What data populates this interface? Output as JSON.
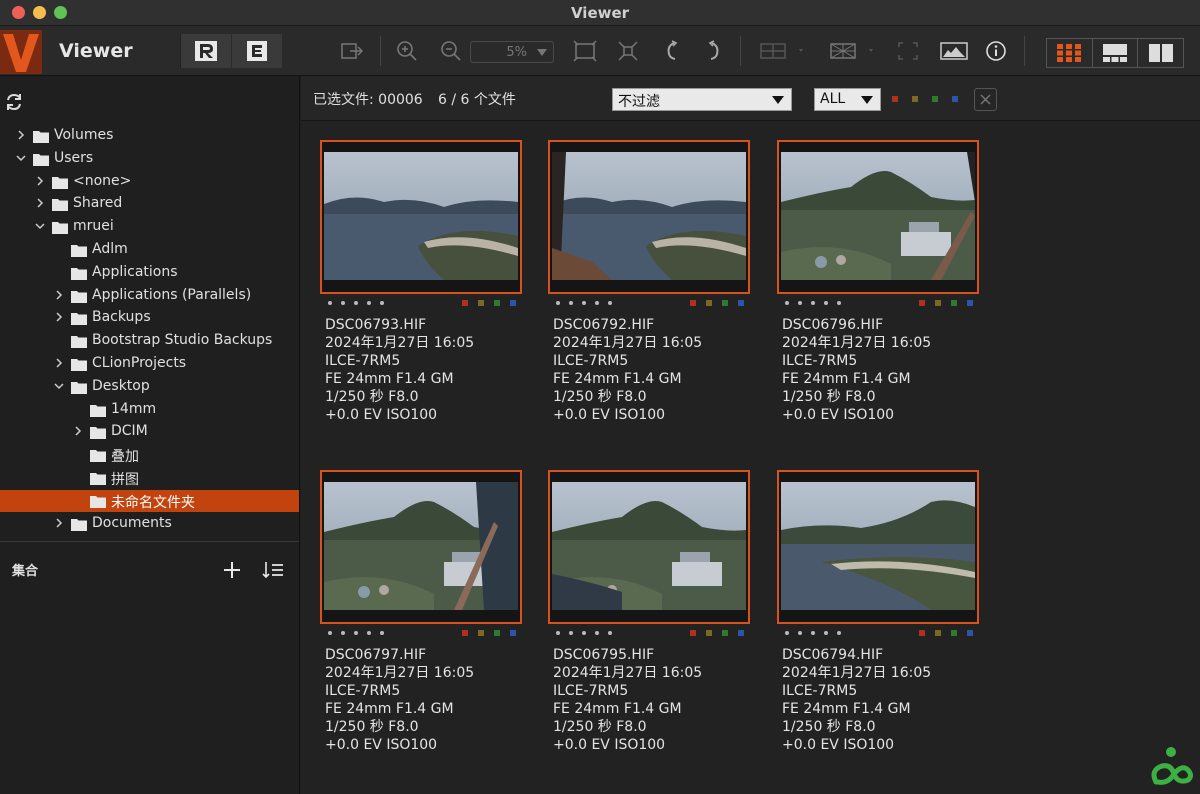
{
  "window": {
    "title": "Viewer"
  },
  "app": {
    "name": "Viewer",
    "logo_letter": "V"
  },
  "toolbar": {
    "zoom": "5%",
    "icons": [
      "edit-r-icon",
      "export-e-icon",
      "export-arrow-icon",
      "zoom-in-icon",
      "zoom-out-icon",
      "fit-icon",
      "actual-size-icon",
      "rotate-left-icon",
      "rotate-right-icon",
      "compare-icon",
      "grid-overlay-icon",
      "crop-icon",
      "histogram-icon",
      "info-icon",
      "grid-view-icon",
      "browser-view-icon",
      "dual-view-icon"
    ]
  },
  "sidebar": {
    "tree": [
      {
        "label": "Volumes",
        "indent": 0,
        "chevron": "right"
      },
      {
        "label": "Users",
        "indent": 0,
        "chevron": "down"
      },
      {
        "label": "<none>",
        "indent": 1,
        "chevron": "right"
      },
      {
        "label": "Shared",
        "indent": 1,
        "chevron": "right"
      },
      {
        "label": "mruei",
        "indent": 1,
        "chevron": "down"
      },
      {
        "label": "Adlm",
        "indent": 2,
        "chevron": ""
      },
      {
        "label": "Applications",
        "indent": 2,
        "chevron": ""
      },
      {
        "label": "Applications (Parallels)",
        "indent": 2,
        "chevron": "right"
      },
      {
        "label": "Backups",
        "indent": 2,
        "chevron": "right"
      },
      {
        "label": "Bootstrap Studio Backups",
        "indent": 2,
        "chevron": ""
      },
      {
        "label": "CLionProjects",
        "indent": 2,
        "chevron": "right"
      },
      {
        "label": "Desktop",
        "indent": 2,
        "chevron": "down"
      },
      {
        "label": "14mm",
        "indent": 3,
        "chevron": ""
      },
      {
        "label": "DCIM",
        "indent": 3,
        "chevron": "right"
      },
      {
        "label": "叠加",
        "indent": 3,
        "chevron": ""
      },
      {
        "label": "拼图",
        "indent": 3,
        "chevron": ""
      },
      {
        "label": "未命名文件夹",
        "indent": 3,
        "chevron": "",
        "selected": true
      },
      {
        "label": "Documents",
        "indent": 2,
        "chevron": "right"
      }
    ],
    "collections_label": "集合"
  },
  "filterbar": {
    "selected_files": "已选文件: 00006",
    "file_count": "6 / 6 个文件",
    "filter_value": "不过滤",
    "all_value": "ALL",
    "color_labels": [
      "#b03020",
      "#7a6a20",
      "#2e7a30",
      "#2a55a8"
    ]
  },
  "thumbnails": [
    {
      "filename": "DSC06793.HIF",
      "date": "2024年1月27日 16:05",
      "camera": "ILCE-7RM5",
      "lens": "FE 24mm F1.4 GM",
      "exposure": "1/250 秒 F8.0",
      "ev_iso": "+0.0 EV ISO100",
      "scene": "lake"
    },
    {
      "filename": "DSC06792.HIF",
      "date": "2024年1月27日 16:05",
      "camera": "ILCE-7RM5",
      "lens": "FE 24mm F1.4 GM",
      "exposure": "1/250 秒 F8.0",
      "ev_iso": "+0.0 EV ISO100",
      "scene": "lake-wide"
    },
    {
      "filename": "DSC06796.HIF",
      "date": "2024年1月27日 16:05",
      "camera": "ILCE-7RM5",
      "lens": "FE 24mm F1.4 GM",
      "exposure": "1/250 秒 F8.0",
      "ev_iso": "+0.0 EV ISO100",
      "scene": "hill"
    },
    {
      "filename": "DSC06797.HIF",
      "date": "2024年1月27日 16:05",
      "camera": "ILCE-7RM5",
      "lens": "FE 24mm F1.4 GM",
      "exposure": "1/250 秒 F8.0",
      "ev_iso": "+0.0 EV ISO100",
      "scene": "hill-window"
    },
    {
      "filename": "DSC06795.HIF",
      "date": "2024年1月27日 16:05",
      "camera": "ILCE-7RM5",
      "lens": "FE 24mm F1.4 GM",
      "exposure": "1/250 秒 F8.0",
      "ev_iso": "+0.0 EV ISO100",
      "scene": "hill-village"
    },
    {
      "filename": "DSC06794.HIF",
      "date": "2024年1月27日 16:05",
      "camera": "ILCE-7RM5",
      "lens": "FE 24mm F1.4 GM",
      "exposure": "1/250 秒 F8.0",
      "ev_iso": "+0.0 EV ISO100",
      "scene": "lake-hill"
    }
  ],
  "colors": {
    "accent": "#d8531c",
    "selection": "#c3430f",
    "background": "#1e1e1e"
  }
}
